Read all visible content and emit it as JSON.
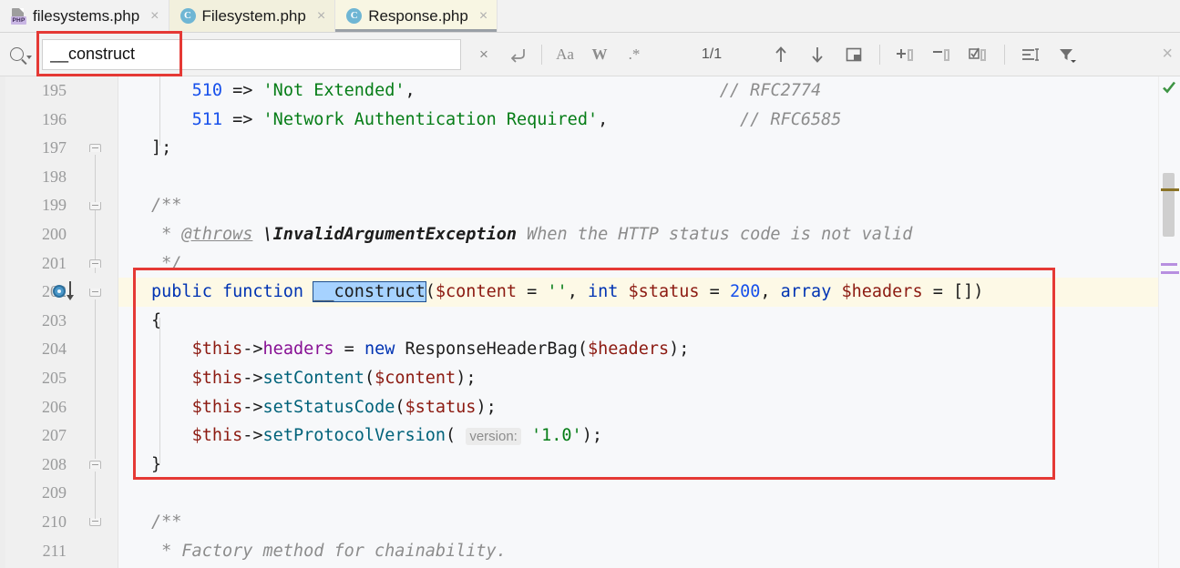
{
  "window": {
    "app": "PhpStorm editor"
  },
  "tabs": [
    {
      "label": "filesystems.php",
      "icon": "php-file-icon",
      "state": "plain",
      "close": "×"
    },
    {
      "label": "Filesystem.php",
      "icon": "class-icon",
      "state": "tinted",
      "close": "×"
    },
    {
      "label": "Response.php",
      "icon": "class-icon",
      "state": "active",
      "close": "×"
    }
  ],
  "find": {
    "search_icon": "search-icon",
    "value": "__construct",
    "placeholder": "",
    "clear_label": "×",
    "reset_label": "↵",
    "match_case_label": "Aa",
    "words_label": "W",
    "regex_label": ".*",
    "counter": "1/1",
    "prev_label": "↑",
    "next_label": "↓",
    "select_all_label": "select-all-icon",
    "add_label": "add-clause-icon",
    "remove_label": "remove-clause-icon",
    "toggle_label": "toggle-clause-icon",
    "indent_label": "indent-icon",
    "filter_label": "filter-icon",
    "close_label": "×"
  },
  "gutter": {
    "line_numbers": [
      "195",
      "196",
      "197",
      "198",
      "199",
      "200",
      "201",
      "202",
      "203",
      "204",
      "205",
      "206",
      "207",
      "208",
      "209",
      "210",
      "211"
    ],
    "run_marker_line": "202"
  },
  "code": {
    "lines": [
      {
        "n": "195",
        "caret": false,
        "tokens": [
          {
            "t": "    ",
            "c": "pl"
          },
          {
            "t": "510",
            "c": "num"
          },
          {
            "t": " => ",
            "c": "pl"
          },
          {
            "t": "'Not Extended'",
            "c": "str"
          },
          {
            "t": ",",
            "c": "pl"
          },
          {
            "t": "                              ",
            "c": "pl"
          },
          {
            "t": "// RFC2774",
            "c": "cmt"
          }
        ]
      },
      {
        "n": "196",
        "caret": false,
        "tokens": [
          {
            "t": "    ",
            "c": "pl"
          },
          {
            "t": "511",
            "c": "num"
          },
          {
            "t": " => ",
            "c": "pl"
          },
          {
            "t": "'Network Authentication Required'",
            "c": "str"
          },
          {
            "t": ",",
            "c": "pl"
          },
          {
            "t": "             ",
            "c": "pl"
          },
          {
            "t": "// RFC6585",
            "c": "cmt"
          }
        ]
      },
      {
        "n": "197",
        "caret": false,
        "tokens": [
          {
            "t": "];",
            "c": "pl"
          }
        ]
      },
      {
        "n": "198",
        "caret": false,
        "tokens": [
          {
            "t": "",
            "c": "pl"
          }
        ]
      },
      {
        "n": "199",
        "caret": false,
        "tokens": [
          {
            "t": "/**",
            "c": "doc"
          }
        ]
      },
      {
        "n": "200",
        "caret": false,
        "tokens": [
          {
            "t": " * ",
            "c": "doc"
          },
          {
            "t": "@throws",
            "c": "doctag"
          },
          {
            "t": " ",
            "c": "doc"
          },
          {
            "t": "\\InvalidArgumentException",
            "c": "doctype"
          },
          {
            "t": " When the HTTP status code is not valid",
            "c": "doc"
          }
        ]
      },
      {
        "n": "201",
        "caret": false,
        "tokens": [
          {
            "t": " */",
            "c": "doc"
          }
        ]
      },
      {
        "n": "202",
        "caret": true,
        "tokens": [
          {
            "t": "public",
            "c": "k"
          },
          {
            "t": " ",
            "c": "pl"
          },
          {
            "t": "function",
            "c": "k"
          },
          {
            "t": " ",
            "c": "pl"
          },
          {
            "t": "__construct",
            "c": "match"
          },
          {
            "t": "(",
            "c": "pl"
          },
          {
            "t": "$content",
            "c": "dvar"
          },
          {
            "t": " = ",
            "c": "pl"
          },
          {
            "t": "''",
            "c": "str"
          },
          {
            "t": ", ",
            "c": "pl"
          },
          {
            "t": "int",
            "c": "k"
          },
          {
            "t": " ",
            "c": "pl"
          },
          {
            "t": "$status",
            "c": "dvar"
          },
          {
            "t": " = ",
            "c": "pl"
          },
          {
            "t": "200",
            "c": "num"
          },
          {
            "t": ", ",
            "c": "pl"
          },
          {
            "t": "array",
            "c": "k"
          },
          {
            "t": " ",
            "c": "pl"
          },
          {
            "t": "$headers",
            "c": "dvar"
          },
          {
            "t": " = ",
            "c": "pl"
          },
          {
            "t": "[])",
            "c": "pl"
          }
        ]
      },
      {
        "n": "203",
        "caret": false,
        "tokens": [
          {
            "t": "{",
            "c": "pl"
          }
        ]
      },
      {
        "n": "204",
        "caret": false,
        "tokens": [
          {
            "t": "    ",
            "c": "pl"
          },
          {
            "t": "$this",
            "c": "dvar"
          },
          {
            "t": "->",
            "c": "pl"
          },
          {
            "t": "headers",
            "c": "var"
          },
          {
            "t": " = ",
            "c": "pl"
          },
          {
            "t": "new",
            "c": "k"
          },
          {
            "t": " ",
            "c": "pl"
          },
          {
            "t": "ResponseHeaderBag",
            "c": "cls"
          },
          {
            "t": "(",
            "c": "pl"
          },
          {
            "t": "$headers",
            "c": "dvar"
          },
          {
            "t": ");",
            "c": "pl"
          }
        ]
      },
      {
        "n": "205",
        "caret": false,
        "tokens": [
          {
            "t": "    ",
            "c": "pl"
          },
          {
            "t": "$this",
            "c": "dvar"
          },
          {
            "t": "->",
            "c": "pl"
          },
          {
            "t": "setContent",
            "c": "fn"
          },
          {
            "t": "(",
            "c": "pl"
          },
          {
            "t": "$content",
            "c": "dvar"
          },
          {
            "t": ");",
            "c": "pl"
          }
        ]
      },
      {
        "n": "206",
        "caret": false,
        "tokens": [
          {
            "t": "    ",
            "c": "pl"
          },
          {
            "t": "$this",
            "c": "dvar"
          },
          {
            "t": "->",
            "c": "pl"
          },
          {
            "t": "setStatusCode",
            "c": "fn"
          },
          {
            "t": "(",
            "c": "pl"
          },
          {
            "t": "$status",
            "c": "dvar"
          },
          {
            "t": ");",
            "c": "pl"
          }
        ]
      },
      {
        "n": "207",
        "caret": false,
        "tokens": [
          {
            "t": "    ",
            "c": "pl"
          },
          {
            "t": "$this",
            "c": "dvar"
          },
          {
            "t": "->",
            "c": "pl"
          },
          {
            "t": "setProtocolVersion",
            "c": "fn"
          },
          {
            "t": "( ",
            "c": "pl"
          },
          {
            "t": "version:",
            "c": "hint"
          },
          {
            "t": " ",
            "c": "pl"
          },
          {
            "t": "'1.0'",
            "c": "str"
          },
          {
            "t": ");",
            "c": "pl"
          }
        ]
      },
      {
        "n": "208",
        "caret": false,
        "tokens": [
          {
            "t": "}",
            "c": "pl"
          }
        ]
      },
      {
        "n": "209",
        "caret": false,
        "tokens": [
          {
            "t": "",
            "c": "pl"
          }
        ]
      },
      {
        "n": "210",
        "caret": false,
        "tokens": [
          {
            "t": "/**",
            "c": "doc"
          }
        ]
      },
      {
        "n": "211",
        "caret": false,
        "tokens": [
          {
            "t": " * Factory method for chainability.",
            "c": "doc"
          }
        ]
      }
    ]
  },
  "inspection": {
    "status": "ok-check-icon",
    "markers": [
      "#8a7326",
      "#b78fe0",
      "#b78fe0"
    ]
  },
  "colors": {
    "keyword": "#0033b3",
    "string": "#067d17",
    "number": "#1750eb",
    "variable": "#8c1a11",
    "field": "#871094",
    "method": "#00627a",
    "comment": "#8c8c8c",
    "match_highlight": "#a6d2ff",
    "caret_line": "#fdf9e6",
    "annotation": "#e53935"
  },
  "annotations": [
    {
      "name": "search-field-highlight"
    },
    {
      "name": "method-block-highlight"
    }
  ]
}
